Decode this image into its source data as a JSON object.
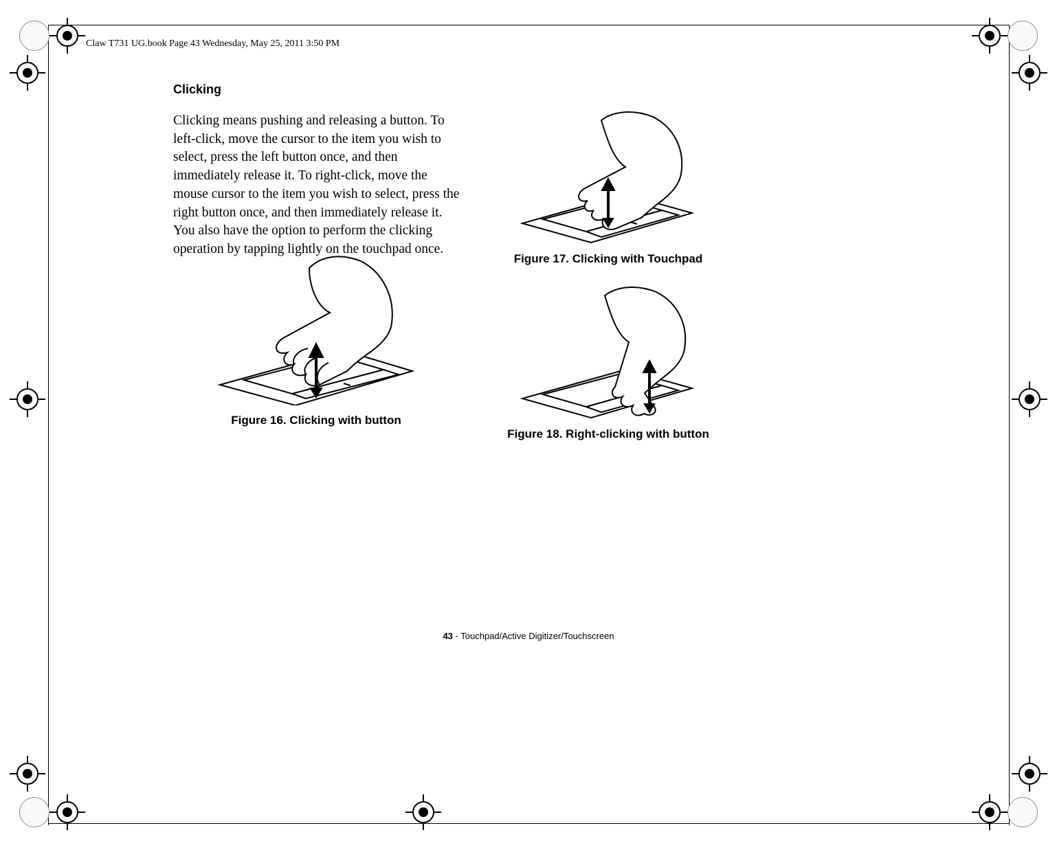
{
  "header_note": "Claw T731 UG.book  Page 43  Wednesday, May 25, 2011  3:50 PM",
  "section": {
    "title": "Clicking",
    "body": "Clicking means pushing and releasing a button. To left-click, move the cursor to the item you wish to select, press the left button once, and then immediately release it. To right-click, move the mouse cursor to the item you wish to select, press the right button once, and then immediately release it. You also have the option to perform the clicking operation by tapping lightly on the touchpad once."
  },
  "figures": {
    "fig16": {
      "caption": "Figure 16.  Clicking with button"
    },
    "fig17": {
      "caption": "Figure 17.  Clicking with Touchpad"
    },
    "fig18": {
      "caption": "Figure 18.  Right-clicking with button"
    }
  },
  "footer": {
    "page_number": "43",
    "separator": " - ",
    "trail": "Touchpad/Active Digitizer/Touchscreen"
  }
}
